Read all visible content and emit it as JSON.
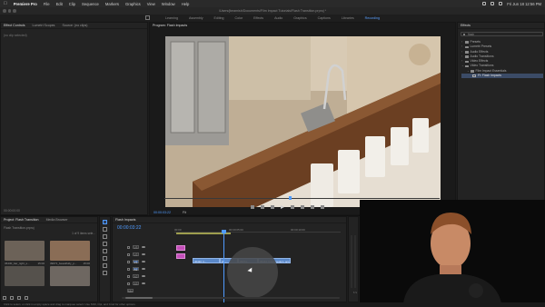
{
  "menubar": {
    "app_name": "Premiere Pro",
    "items": [
      "File",
      "Edit",
      "Clip",
      "Sequence",
      "Markers",
      "Graphics",
      "View",
      "Window",
      "Help"
    ],
    "clock": "Fri Jun 18  12:56 PM"
  },
  "window": {
    "title": "/Users/jbeamish/Documents/Film Impact Tutorials/Flash Transition.prproj *"
  },
  "workspaces": {
    "items": [
      "Learning",
      "Assembly",
      "Editing",
      "Color",
      "Effects",
      "Audio",
      "Graphics",
      "Captions",
      "Libraries",
      "Recording"
    ],
    "active": "Recording"
  },
  "effect_controls": {
    "tabs": [
      "Effect Controls",
      "Lumetri Scopes",
      "Source: (no clips)"
    ],
    "placeholder": "(no clip selected)",
    "timecode": "00:00:00:00"
  },
  "program_monitor": {
    "tab": "Program: Flash Impacts",
    "timecode": "00:00:03:22",
    "fit": "Fit",
    "quality": "Full",
    "duration": "00:00:09:04"
  },
  "effects_panel": {
    "tab": "Effects",
    "search_value": "flash",
    "tree": [
      {
        "label": "Presets",
        "level": 0
      },
      {
        "label": "Lumetri Presets",
        "level": 0
      },
      {
        "label": "Audio Effects",
        "level": 0
      },
      {
        "label": "Audio Transitions",
        "level": 0
      },
      {
        "label": "Video Effects",
        "level": 0
      },
      {
        "label": "Video Transitions",
        "level": 0
      },
      {
        "label": "Film Impact Essentials",
        "level": 1
      },
      {
        "label": "FI: Flash Impacts",
        "level": 2
      }
    ]
  },
  "project_panel": {
    "tabs": [
      "Project: Flash Transition",
      "Media Browser"
    ],
    "breadcrumb": "Flash Transition.prproj",
    "item_count": "1 of 9 items sele...",
    "thumbnails": [
      {
        "label": "36430_bar_right_s...",
        "duration": "15:00",
        "color": "#6c6258"
      },
      {
        "label": "39071_beautifully_p...",
        "duration": "15:00",
        "color": "#8a6d56"
      },
      {
        "label": "",
        "duration": "",
        "color": "#55514c"
      },
      {
        "label": "",
        "duration": "",
        "color": "#6e6761"
      }
    ]
  },
  "timeline": {
    "tab": "Flash Impacts",
    "timecode": "00:00:03:22",
    "ruler": [
      "00:00",
      "00:00:05:00",
      "00:00:10:00"
    ],
    "tracks": [
      "V3",
      "V2",
      "V1",
      "A1",
      "A2",
      "A3",
      "Mix"
    ],
    "clips": [
      {
        "label": "",
        "track": "V2",
        "kind": "pink"
      },
      {
        "label": "",
        "track": "V1",
        "kind": "pink"
      },
      {
        "label": "36430_b...",
        "track": "V1",
        "kind": "video"
      },
      {
        "label": "36...",
        "track": "V1",
        "kind": "video"
      },
      {
        "label": "39071...",
        "track": "V1",
        "kind": "video"
      },
      {
        "label": "39444_hotel_modern_acc...",
        "track": "V1",
        "kind": "video"
      }
    ]
  },
  "audio_meter": {
    "labels": [
      "S",
      "S"
    ]
  },
  "statusbar": {
    "text": "Click to select, or click in empty space and drag to marquee select. Use Shift, Opt, and Cmd for other options."
  }
}
